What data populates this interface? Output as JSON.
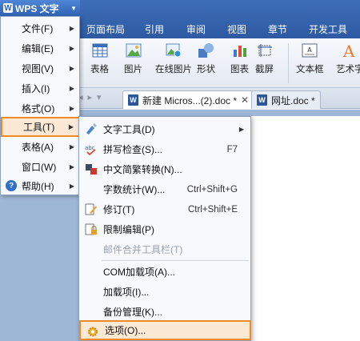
{
  "app": {
    "title": "WPS 文字",
    "logo_glyph": "W"
  },
  "ribbon_tabs": [
    "页面布局",
    "引用",
    "审阅",
    "视图",
    "章节",
    "开发工具"
  ],
  "toolbar": {
    "table": "表格",
    "image": "图片",
    "online_image": "在线图片",
    "shape": "形状",
    "chart": "图表",
    "screenshot": "截屏",
    "textbox": "文本框",
    "art_text": "艺术字"
  },
  "doc_tabs": {
    "active": "新建 Micros...(2).doc *",
    "close_glyph": "✕",
    "inactive": "网址.doc *"
  },
  "main_menu": [
    {
      "label": "文件(F)"
    },
    {
      "label": "编辑(E)"
    },
    {
      "label": "视图(V)"
    },
    {
      "label": "插入(I)"
    },
    {
      "label": "格式(O)"
    },
    {
      "label": "工具(T)"
    },
    {
      "label": "表格(A)"
    },
    {
      "label": "窗口(W)"
    },
    {
      "label": "帮助(H)"
    }
  ],
  "tools_menu": [
    {
      "label": "文字工具(D)",
      "icon": "text-tools-icon"
    },
    {
      "label": "拼写检查(S)...",
      "shortcut": "F7",
      "icon": "spell-check-icon"
    },
    {
      "label": "中文简繁转换(N)...",
      "icon": "chinese-conversion-icon"
    },
    {
      "label": "字数统计(W)...",
      "shortcut": "Ctrl+Shift+G"
    },
    {
      "label": "修订(T)",
      "shortcut": "Ctrl+Shift+E",
      "icon": "track-changes-icon"
    },
    {
      "label": "限制编辑(P)",
      "icon": "restrict-edit-icon"
    },
    {
      "label": "邮件合并工具栏(T)"
    },
    {
      "label": "COM加载项(A)..."
    },
    {
      "label": "加载项(I)..."
    },
    {
      "label": "备份管理(K)..."
    },
    {
      "label": "选项(O)...",
      "icon": "options-gear-icon"
    }
  ],
  "colors": {
    "highlight_border": "#f08a24",
    "highlight_fill": "#fbe9d6",
    "title_blue": "#2d5aa2"
  }
}
